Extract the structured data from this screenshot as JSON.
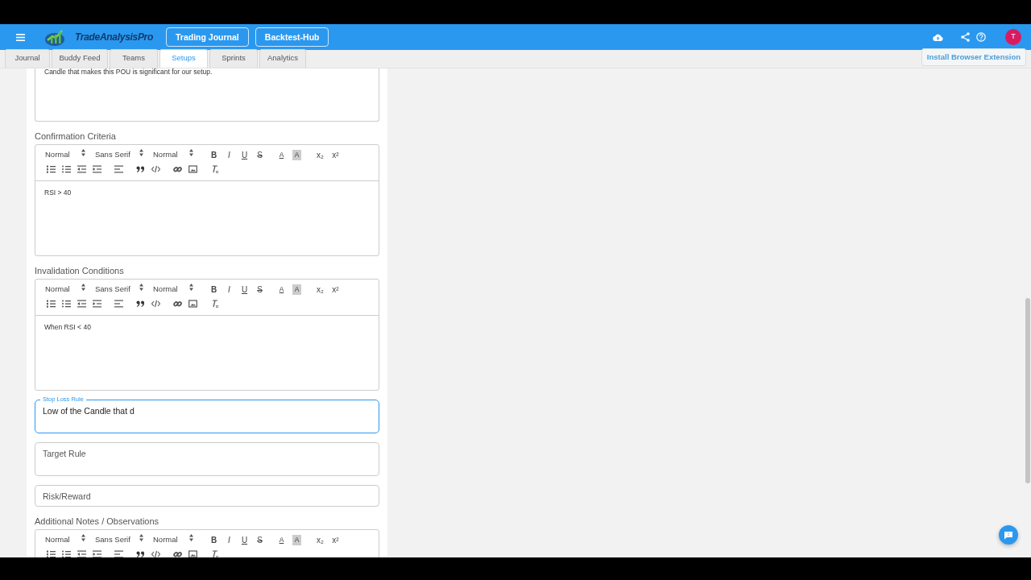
{
  "header": {
    "brand": "TradeAnalysisPro",
    "nav_buttons": [
      "Trading Journal",
      "Backtest-Hub"
    ],
    "avatar": "T"
  },
  "tabs": [
    {
      "label": "Journal",
      "selected": false
    },
    {
      "label": "Buddy Feed",
      "selected": false
    },
    {
      "label": "Teams",
      "selected": false
    },
    {
      "label": "Setups",
      "selected": true
    },
    {
      "label": "Sprints",
      "selected": false
    },
    {
      "label": "Analytics",
      "selected": false
    }
  ],
  "extension_button": "Install Browser Extension",
  "fields": [
    {
      "kind": "editor_tail",
      "content": "Candle that makes this POU is significant for our setup."
    },
    {
      "kind": "editor",
      "label": "Confirmation Criteria",
      "toolbar": {
        "selects": [
          "Normal",
          "Sans Serif",
          "Normal"
        ],
        "buttons": [
          "B",
          "I",
          "U",
          "S",
          "A",
          "A",
          "x₂",
          "x²"
        ]
      },
      "content": "RSI > 40"
    },
    {
      "kind": "editor",
      "label": "Invalidation Conditions",
      "toolbar": {
        "selects": [
          "Normal",
          "Sans Serif",
          "Normal"
        ],
        "buttons": [
          "B",
          "I",
          "U",
          "S",
          "A",
          "A",
          "x₂",
          "x²"
        ]
      },
      "content": "When RSI < 40"
    },
    {
      "kind": "text",
      "label": "Stop Loss Rule",
      "value": "Low of the Candle that d",
      "focused": true,
      "multiline": true
    },
    {
      "kind": "text",
      "placeholder": "Target Rule",
      "focused": false,
      "multiline": true
    },
    {
      "kind": "text",
      "placeholder": "Risk/Reward",
      "focused": false,
      "multiline": false
    },
    {
      "kind": "editor",
      "label": "Additional Notes / Observations",
      "toolbar": {
        "selects": [
          "Normal",
          "Sans Serif",
          "Normal"
        ],
        "buttons": [
          "B",
          "I",
          "U",
          "S",
          "A",
          "A",
          "x₂",
          "x²"
        ]
      }
    }
  ]
}
